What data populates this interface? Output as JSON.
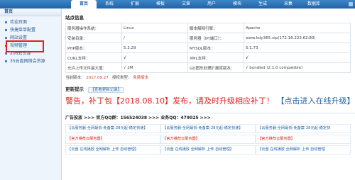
{
  "nav": {
    "items": [
      "首页",
      "系统",
      "扩展",
      "模板",
      "文章",
      "用户",
      "模块",
      "生成",
      "采集",
      "数据库"
    ],
    "active": 0
  },
  "sidebar": {
    "title": "首页",
    "items": [
      "欢迎页面",
      "快捷菜单配置",
      "网站设置",
      "视频管理",
      "206云资源",
      "35云盘网络会资源"
    ]
  },
  "site_info": {
    "title": "站点信息",
    "rows": [
      [
        "服务器操作系统：",
        "Linux",
        "脚本解释引擎：",
        "Apache"
      ],
      [
        "安装目录：",
        "/",
        "服务器（IP/端口）：",
        "www.kdy365.vip(172.16.223.62:80)"
      ],
      [
        "PHP版本：",
        "5.3.29",
        "MYSQL版本：",
        "5.1.73"
      ],
      [
        "CURL支持：",
        "√",
        "XML支持：",
        "√"
      ],
      [
        "允许上传文件最大值：",
        "√ 2M",
        "GD图形处理扩展库版本：",
        "√ bundled (2.1.0 compatible)"
      ]
    ],
    "version_label": "当前版本：",
    "version": "2017.09.27",
    "license_label": "授权类型：",
    "license": "免费版本"
  },
  "updates": {
    "title": "更新提示",
    "link": "【查看更新记录】",
    "warning": "警告，补丁包【2018.08.10】发布，请及时升级相应补丁！",
    "warning_link": "【点击进入在线升级】【点击"
  },
  "ads": {
    "header": "广告投放 >>> 官方QQ群：156524038 >>> 业务QQ：479025 >>>",
    "cells": [
      "【云服务器-全网最低-免备案-28元起-稳定快速】",
      "【云服务器-全网最低-免备案-28元起-稳定快速】",
      "【云服务器-全网最低-免备案-28元起-稳定快",
      "【官方推荐云服务器】",
      "【官方推荐云服务器】",
      "【官方推荐云服务器】",
      "【云盘 在线播放 全网解析 上传 自动管理】",
      "【云盘 在线播放 全网解析 上传 自动管理】",
      "【云盘 在线播放 全网解析 上传 自动管理"
    ]
  },
  "colors": {
    "nav_bg": "#1f63a8",
    "warning": "#e0201c",
    "link": "#1f63a8",
    "highlight_box": "#e0201c"
  }
}
